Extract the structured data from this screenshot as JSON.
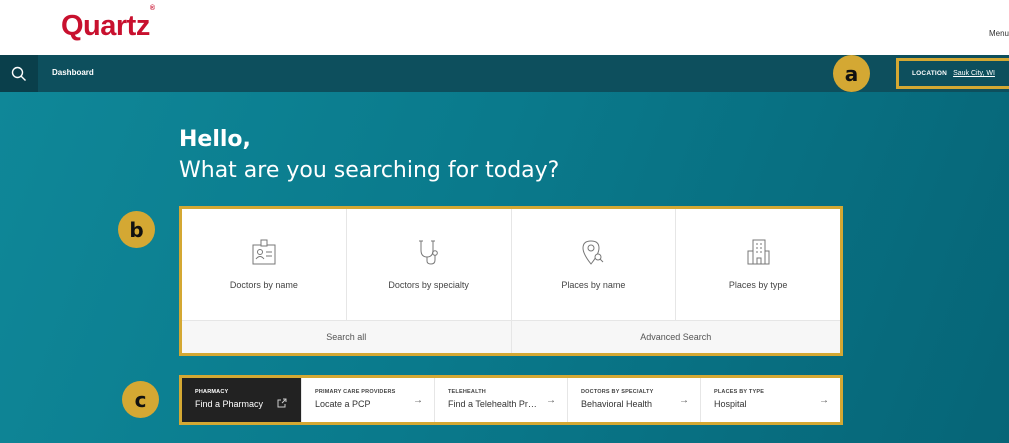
{
  "header": {
    "logo_text": "Quartz",
    "logo_mark": "®",
    "menu_label": "Menu"
  },
  "navbar": {
    "title": "Dashboard",
    "location_label": "LOCATION",
    "location_value": "Sauk City, WI"
  },
  "badges": {
    "a": "a",
    "b": "b",
    "c": "c"
  },
  "hero": {
    "greeting": "Hello,",
    "question": "What are you searching for today?"
  },
  "search_tiles": [
    {
      "label": "Doctors by name",
      "icon": "id-card-icon"
    },
    {
      "label": "Doctors by specialty",
      "icon": "stethoscope-icon"
    },
    {
      "label": "Places by name",
      "icon": "map-pin-search-icon"
    },
    {
      "label": "Places by type",
      "icon": "building-icon"
    }
  ],
  "search_actions": {
    "search_all": "Search all",
    "advanced": "Advanced Search"
  },
  "quick_links": [
    {
      "category": "PHARMACY",
      "text": "Find a Pharmacy",
      "icon": "external-link-icon"
    },
    {
      "category": "PRIMARY CARE PROVIDERS",
      "text": "Locate a PCP",
      "icon": "arrow-right-icon"
    },
    {
      "category": "TELEHEALTH",
      "text": "Find a Telehealth Pr…",
      "icon": "arrow-right-icon"
    },
    {
      "category": "DOCTORS BY SPECIALTY",
      "text": "Behavioral Health",
      "icon": "arrow-right-icon"
    },
    {
      "category": "PLACES BY TYPE",
      "text": "Hospital",
      "icon": "arrow-right-icon"
    }
  ],
  "colors": {
    "brand_red": "#c8102e",
    "navbar": "#0d4f5d",
    "hero_teal": "#0a7a8c",
    "highlight": "#d4a833"
  }
}
